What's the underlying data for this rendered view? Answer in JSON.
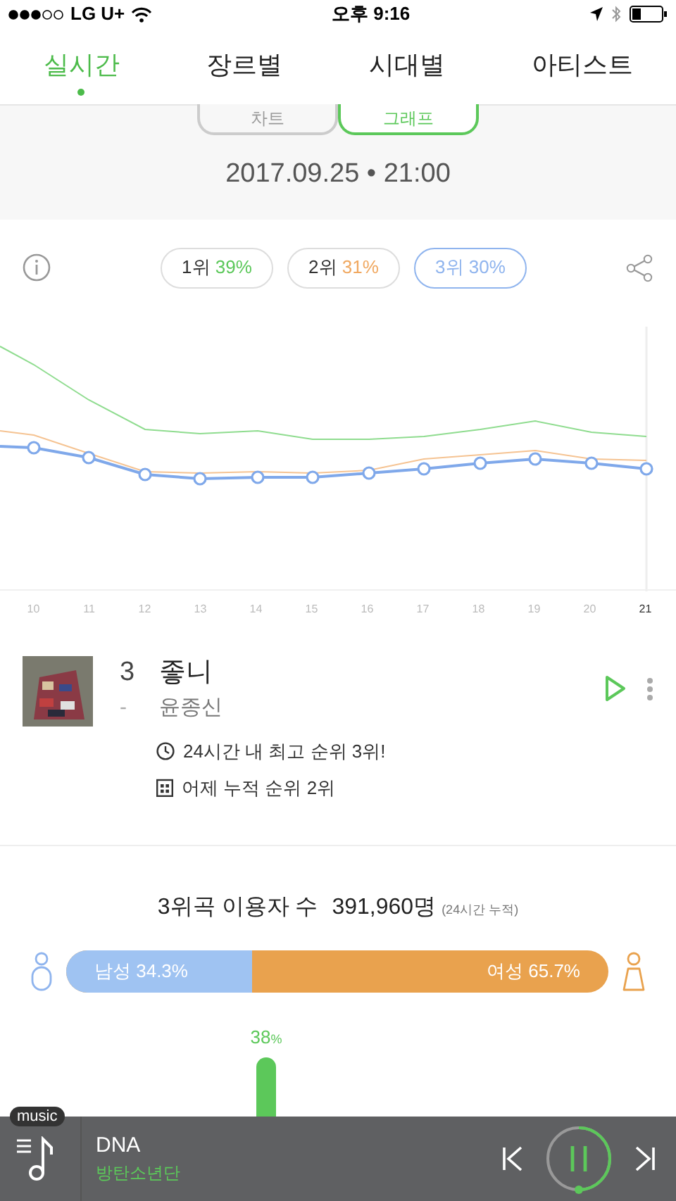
{
  "status_bar": {
    "carrier": "LG U+",
    "time": "오후 9:16"
  },
  "tabs": [
    {
      "label": "실시간",
      "selected": true
    },
    {
      "label": "장르별",
      "selected": false
    },
    {
      "label": "시대별",
      "selected": false
    },
    {
      "label": "아티스트",
      "selected": false
    }
  ],
  "view_toggle": [
    {
      "label": "차트",
      "selected": false
    },
    {
      "label": "그래프",
      "selected": true
    }
  ],
  "timestamp": "2017.09.25 • 21:00",
  "rank_pills": [
    {
      "rank": "1위",
      "share": "39%",
      "color": "#5cc85a",
      "selected": false
    },
    {
      "rank": "2위",
      "share": "31%",
      "color": "#f0a860",
      "selected": false
    },
    {
      "rank": "3위",
      "share": "30%",
      "color": "#8fb4ee",
      "selected": true
    }
  ],
  "x_labels": [
    {
      "label": "10",
      "selected": false
    },
    {
      "label": "11",
      "selected": false
    },
    {
      "label": "12",
      "selected": false
    },
    {
      "label": "13",
      "selected": false
    },
    {
      "label": "14",
      "selected": false
    },
    {
      "label": "15",
      "selected": false
    },
    {
      "label": "16",
      "selected": false
    },
    {
      "label": "17",
      "selected": false
    },
    {
      "label": "18",
      "selected": false
    },
    {
      "label": "19",
      "selected": false
    },
    {
      "label": "20",
      "selected": false
    },
    {
      "label": "21",
      "selected": true
    }
  ],
  "song": {
    "rank": "3",
    "change": "-",
    "title": "좋니",
    "artist": "윤종신",
    "info": [
      {
        "kind": "clock",
        "text": "24시간 내 최고 순위 3위!"
      },
      {
        "kind": "calendar",
        "text": "어제 누적 순위 2위"
      }
    ]
  },
  "listeners": {
    "title": "3위곡 이용자 수",
    "count": "391,960명",
    "note": "(24시간 누적)"
  },
  "gender": {
    "male": "남성 34.3%",
    "female": "여성 65.7%",
    "level": 0.343
  },
  "age_bar": {
    "value": "38",
    "unit": "%"
  },
  "player": {
    "badge": "music",
    "title": "DNA",
    "artist": "방탄소년단"
  }
}
